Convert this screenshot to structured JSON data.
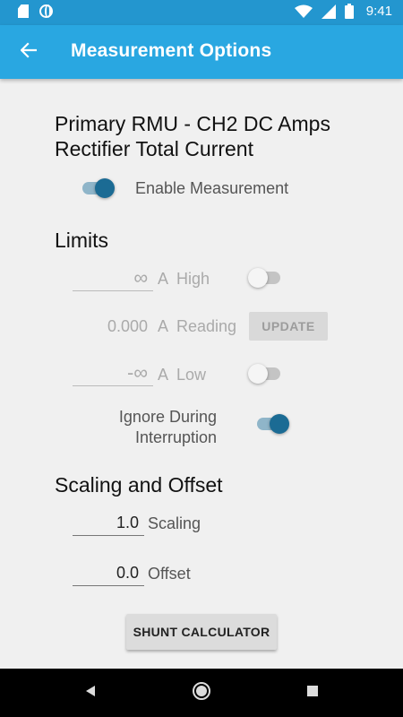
{
  "status_bar": {
    "time": "9:41",
    "icons": [
      "sd-card-icon",
      "globe-icon",
      "wifi-icon",
      "signal-icon",
      "battery-icon"
    ]
  },
  "app_bar": {
    "title": "Measurement Options",
    "back_icon": "arrow-left-icon",
    "color": "#29a7e1"
  },
  "measurement": {
    "title_line1": "Primary RMU - CH2 DC Amps",
    "title_line2": "Rectifier Total Current",
    "enable_label": "Enable Measurement",
    "enabled": true
  },
  "limits": {
    "heading": "Limits",
    "high": {
      "value": "∞",
      "unit": "A",
      "label": "High",
      "alarm_enabled": false
    },
    "reading": {
      "value": "0.000",
      "unit": "A",
      "label": "Reading",
      "button": "UPDATE"
    },
    "low": {
      "value": "-∞",
      "unit": "A",
      "label": "Low",
      "alarm_enabled": false
    },
    "ignore_label": "Ignore During Interruption",
    "ignore_enabled": true
  },
  "scaling": {
    "heading": "Scaling and Offset",
    "scaling_value": "1.0",
    "scaling_label": "Scaling",
    "offset_value": "0.0",
    "offset_label": "Offset",
    "shunt_button": "SHUNT CALCULATOR"
  },
  "nav_bar": {
    "icons": [
      "back-triangle-icon",
      "home-circle-icon",
      "recents-square-icon"
    ]
  }
}
